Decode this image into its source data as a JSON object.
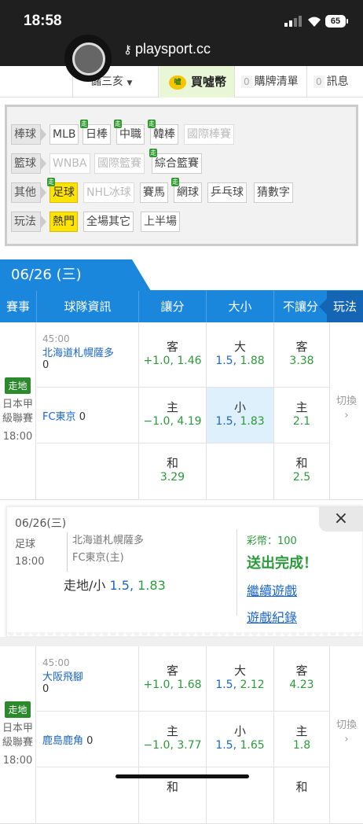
{
  "status": {
    "time": "18:58",
    "battery": "65",
    "url": "playsport.cc"
  },
  "nav": {
    "user": "儲三亥",
    "buy": "買噓幣",
    "coin_icon_text": "噓",
    "cart_count": "0",
    "cart": "購牌清單",
    "msg_count": "0",
    "msg": "訊息"
  },
  "filters": [
    {
      "cat": "棒球",
      "chips": [
        {
          "t": "MLB"
        },
        {
          "t": "日棒",
          "go": "走"
        },
        {
          "t": "中職",
          "go": "走"
        },
        {
          "t": "韓棒",
          "go": "走"
        },
        {
          "t": "國際棒賽",
          "dis": true
        }
      ]
    },
    {
      "cat": "籃球",
      "chips": [
        {
          "t": "WNBA",
          "dis": true
        },
        {
          "t": "國際籃賽",
          "dis": true
        },
        {
          "t": "綜合籃賽",
          "go": "走"
        }
      ]
    },
    {
      "cat": "其他",
      "chips": [
        {
          "t": "足球",
          "go": "走",
          "act": true
        },
        {
          "t": "NHL冰球",
          "dis": true
        },
        {
          "t": "賽馬"
        },
        {
          "t": "網球",
          "go": "走"
        },
        {
          "t": "乒乓球"
        },
        {
          "t": "猜數字"
        }
      ]
    },
    {
      "cat": "玩法",
      "chips": [
        {
          "t": "熱門",
          "act": true
        },
        {
          "t": "全場其它"
        },
        {
          "t": "上半場"
        }
      ]
    }
  ],
  "date_tab": "06/26 (三)",
  "headers": {
    "event": "賽事",
    "team": "球隊資訊",
    "spread": "讓分",
    "total": "大小",
    "moneyline": "不讓分",
    "play": "玩法"
  },
  "matches": [
    {
      "tag": "走地",
      "league": "日本甲級聯賽",
      "time": "18:00",
      "clock": "45:00",
      "away": {
        "name": "北海道札幌薩多",
        "score": "0"
      },
      "home": {
        "name": "FC東京",
        "score": "0"
      },
      "spread": [
        {
          "l1": "客",
          "l2": "+1.0, 1.46"
        },
        {
          "l1": "主",
          "l2": "−1.0, 4.19"
        },
        {
          "l1": "和",
          "l2": "3.29"
        }
      ],
      "total": [
        {
          "l1": "大",
          "a": "1.5,",
          "b": "1.88"
        },
        {
          "l1": "小",
          "a": "1.5,",
          "b": "1.83"
        }
      ],
      "ml": [
        {
          "l1": "客",
          "l2": "3.38"
        },
        {
          "l1": "主",
          "l2": "2.1"
        },
        {
          "l1": "和",
          "l2": "2.5"
        }
      ],
      "switch": "切換"
    },
    {
      "tag": "走地",
      "league": "日本甲級聯賽",
      "time": "18:00",
      "clock": "45:00",
      "away": {
        "name": "大阪飛腳",
        "score": "0"
      },
      "home": {
        "name": "鹿島鹿角",
        "score": "0"
      },
      "spread": [
        {
          "l1": "客",
          "l2": "+1.0, 1.68"
        },
        {
          "l1": "主",
          "l2": "−1.0, 3.77"
        },
        {
          "l1": "和",
          "l2": ""
        }
      ],
      "total": [
        {
          "l1": "大",
          "a": "1.5,",
          "b": "2.12"
        },
        {
          "l1": "小",
          "a": "1.5,",
          "b": "1.65"
        }
      ],
      "ml": [
        {
          "l1": "客",
          "l2": "4.23"
        },
        {
          "l1": "主",
          "l2": "1.8"
        },
        {
          "l1": "和",
          "l2": ""
        }
      ],
      "switch": "切換"
    }
  ],
  "popup": {
    "date": "06/26(三)",
    "sport": "足球",
    "time": "18:00",
    "team_away": "北海道札幌薩多",
    "team_home": "FC東京(主)",
    "bet_label": "走地/小",
    "bet_value": "1.5,",
    "bet_odds": "1.83",
    "coin": "彩幣：100",
    "done": "送出完成！",
    "continue": "繼續遊戲",
    "record": "遊戲紀錄",
    "close": "×"
  }
}
